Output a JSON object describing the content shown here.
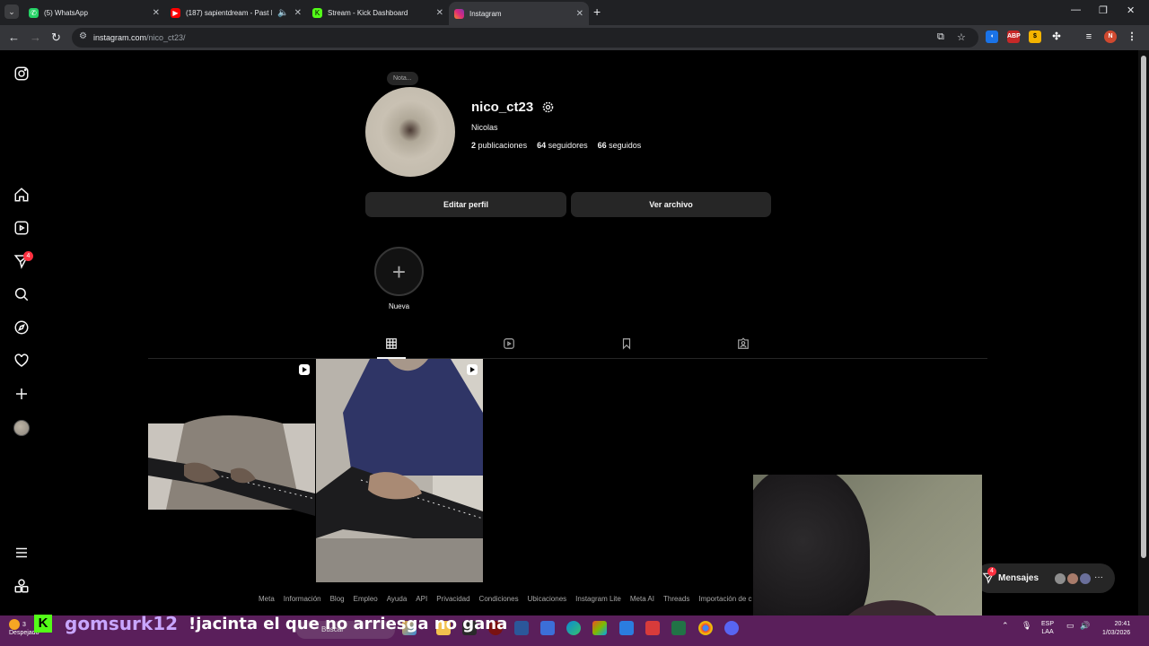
{
  "browser": {
    "tabs": [
      {
        "title": "(5) WhatsApp",
        "color": "#25d366"
      },
      {
        "title": "(187) sapientdream - Past Li",
        "color": "#ff0000"
      },
      {
        "title": "Stream - Kick Dashboard",
        "color": "#53fc18"
      },
      {
        "title": "Instagram",
        "color": "#e1306c"
      }
    ],
    "url_host": "instagram.com",
    "url_path": "/nico_ct23/",
    "profile_initial": "N"
  },
  "profile": {
    "note": "Nota...",
    "username": "nico_ct23",
    "fullname": "Nicolas",
    "posts_count": "2",
    "posts_label": "publicaciones",
    "followers_count": "64",
    "followers_label": "seguidores",
    "following_count": "66",
    "following_label": "seguidos",
    "edit_button": "Editar perfil",
    "archive_button": "Ver archivo",
    "new_story_label": "Nueva"
  },
  "sidebar": {
    "notifications_badge": "4"
  },
  "footer": {
    "links": [
      "Meta",
      "Información",
      "Blog",
      "Empleo",
      "Ayuda",
      "API",
      "Privacidad",
      "Condiciones",
      "Ubicaciones",
      "Instagram Lite",
      "Meta AI",
      "Threads",
      "Importación de c"
    ]
  },
  "messages": {
    "label": "Mensajes",
    "badge": "4"
  },
  "taskbar": {
    "weather_temp": "3",
    "weather_text": "Despejado",
    "search_placeholder": "Buscar",
    "lang_top": "ESP",
    "lang_bottom": "LAA",
    "time": "20:41",
    "date": "1/03/2026"
  },
  "stream_overlay": {
    "username": "gomsurk12",
    "message": "!jacinta el que no arriesga no gana"
  }
}
